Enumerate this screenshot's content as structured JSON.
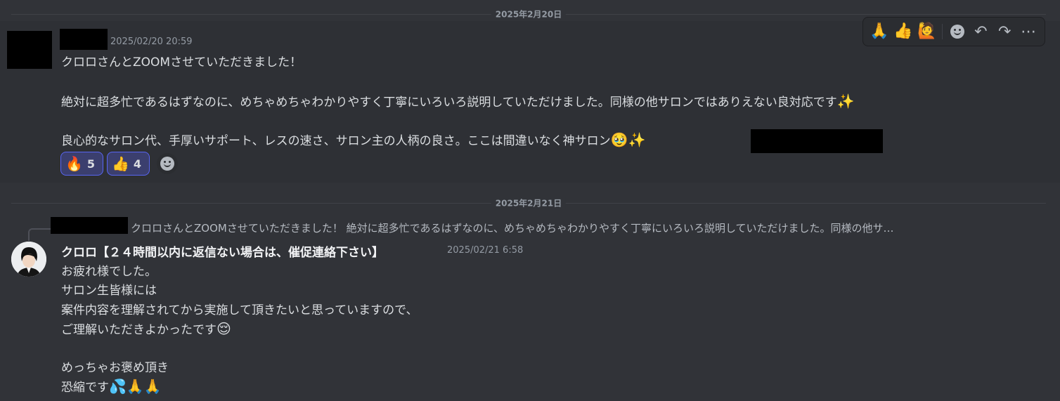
{
  "dividers": {
    "first": "2025年2月20日",
    "second": "2025年2月21日"
  },
  "message1": {
    "timestamp": "2025/02/20 20:59",
    "lines": [
      "クロロさんとZOOMさせていただきました！",
      "絶対に超多忙であるはずなのに、めちゃめちゃわかりやすく丁寧にいろいろ説明していただけました。同様の他サロンではありえない良対応です",
      "良心的なサロン代、手厚いサポート、レスの速さ、サロン主の人柄の良さ。ここは間違いなく神サロン"
    ],
    "line2_emoji": "✨",
    "line3_emojis": "🥹✨",
    "reactions": [
      {
        "emoji": "🔥",
        "count": "5"
      },
      {
        "emoji": "👍",
        "count": "4"
      }
    ]
  },
  "toolbar": {
    "quick_reactions": [
      "🙏",
      "👍",
      "🙋"
    ],
    "icons": [
      "add-reaction-icon",
      "reply-icon",
      "forward-icon",
      "more-icon"
    ],
    "reply_glyph": "↶",
    "forward_glyph": "↷",
    "more_glyph": "⋯"
  },
  "reply": {
    "preview": "クロロさんとZOOMさせていただきました！ 絶対に超多忙であるはずなのに、めちゃめちゃわかりやすく丁寧にいろいろ説明していただけました。同様の他サ…"
  },
  "message2": {
    "author": "クロロ【２４時間以内に返信ない場合は、催促連絡下さい】",
    "timestamp": "2025/02/21 6:58",
    "lines": [
      "お疲れ様でした。",
      "サロン生皆様には",
      "案件内容を理解されてから実施して頂きたいと思っていますので、",
      "ご理解いただきよかったです",
      "めっちゃお褒め頂き",
      "恐縮です"
    ],
    "line4_emoji": "😌",
    "line6_emojis": "💦🙏🙏"
  },
  "colors": {
    "background": "#313338",
    "hover_background": "#2e3035",
    "text": "#dbdee1",
    "muted": "#949ba4",
    "reaction_border": "#5865f2"
  }
}
